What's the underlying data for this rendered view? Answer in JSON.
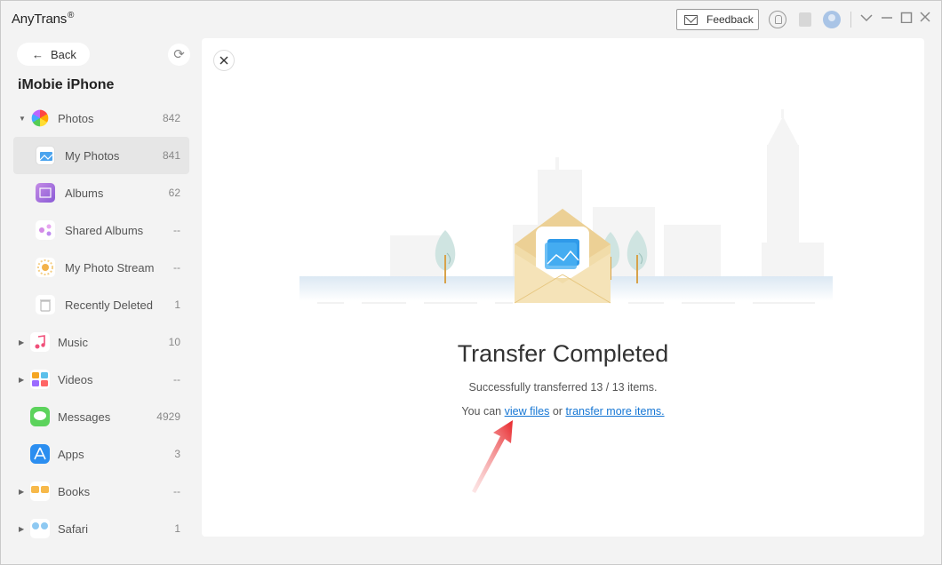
{
  "app": {
    "title": "AnyTrans",
    "mark": "®"
  },
  "toolbar": {
    "feedback_label": "Feedback"
  },
  "sidebar": {
    "back_label": "Back",
    "device_name": "iMobie iPhone",
    "items": [
      {
        "label": "Photos",
        "count": "842"
      },
      {
        "label": "My Photos",
        "count": "841"
      },
      {
        "label": "Albums",
        "count": "62"
      },
      {
        "label": "Shared Albums",
        "count": "--"
      },
      {
        "label": "My Photo Stream",
        "count": "--"
      },
      {
        "label": "Recently Deleted",
        "count": "1"
      },
      {
        "label": "Music",
        "count": "10"
      },
      {
        "label": "Videos",
        "count": "--"
      },
      {
        "label": "Messages",
        "count": "4929"
      },
      {
        "label": "Apps",
        "count": "3"
      },
      {
        "label": "Books",
        "count": "--"
      },
      {
        "label": "Safari",
        "count": "1"
      }
    ]
  },
  "main": {
    "title": "Transfer Completed",
    "subtitle": "Successfully transferred 13 / 13 items.",
    "prefix": "You can",
    "view_files": "view files",
    "or": "or",
    "transfer_more": "transfer more items."
  },
  "colors": {
    "link": "#1576d4",
    "accent_arrow": "#e8262a"
  }
}
